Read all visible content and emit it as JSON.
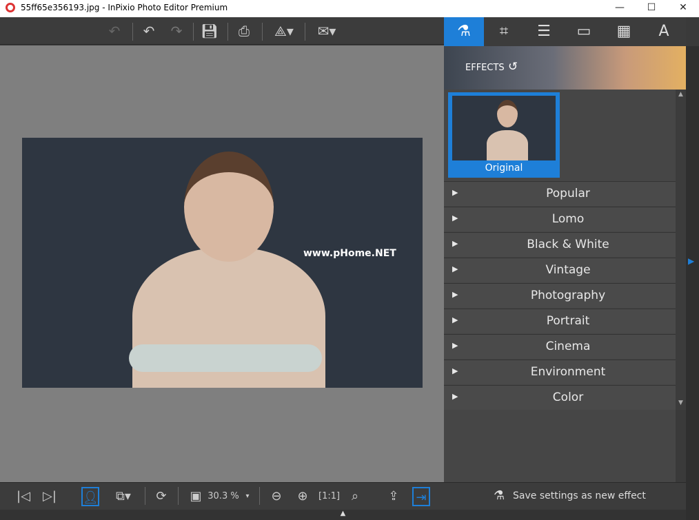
{
  "window": {
    "title": "55ff65e356193.jpg - InPixio Photo Editor Premium",
    "minimize": "—",
    "maximize": "☐",
    "close": "✕"
  },
  "toolbar": {
    "icons": [
      "undo-icon",
      "redo-icon",
      "save-icon",
      "print-icon",
      "share-icon",
      "email-icon"
    ]
  },
  "canvas": {
    "watermark": "www.pHome.NET"
  },
  "panel": {
    "tabs": [
      "effects-icon",
      "crop-icon",
      "adjust-icon",
      "frame-icon",
      "texture-icon",
      "text-icon"
    ],
    "tab_glyphs": [
      "⚗",
      "⌗",
      "☰",
      "▭",
      "▦",
      "A"
    ],
    "active_tab": 0,
    "section_title": "EFFECTS",
    "original_label": "Original",
    "categories": [
      "Popular",
      "Lomo",
      "Black & White",
      "Vintage",
      "Photography",
      "Portrait",
      "Cinema",
      "Environment",
      "Color"
    ]
  },
  "bottombar": {
    "zoom": "30.3 %",
    "save_effect": "Save settings as new effect"
  },
  "colors": {
    "accent": "#1e7fd8",
    "panel": "#464646",
    "canvas": "#7f7f7f"
  }
}
